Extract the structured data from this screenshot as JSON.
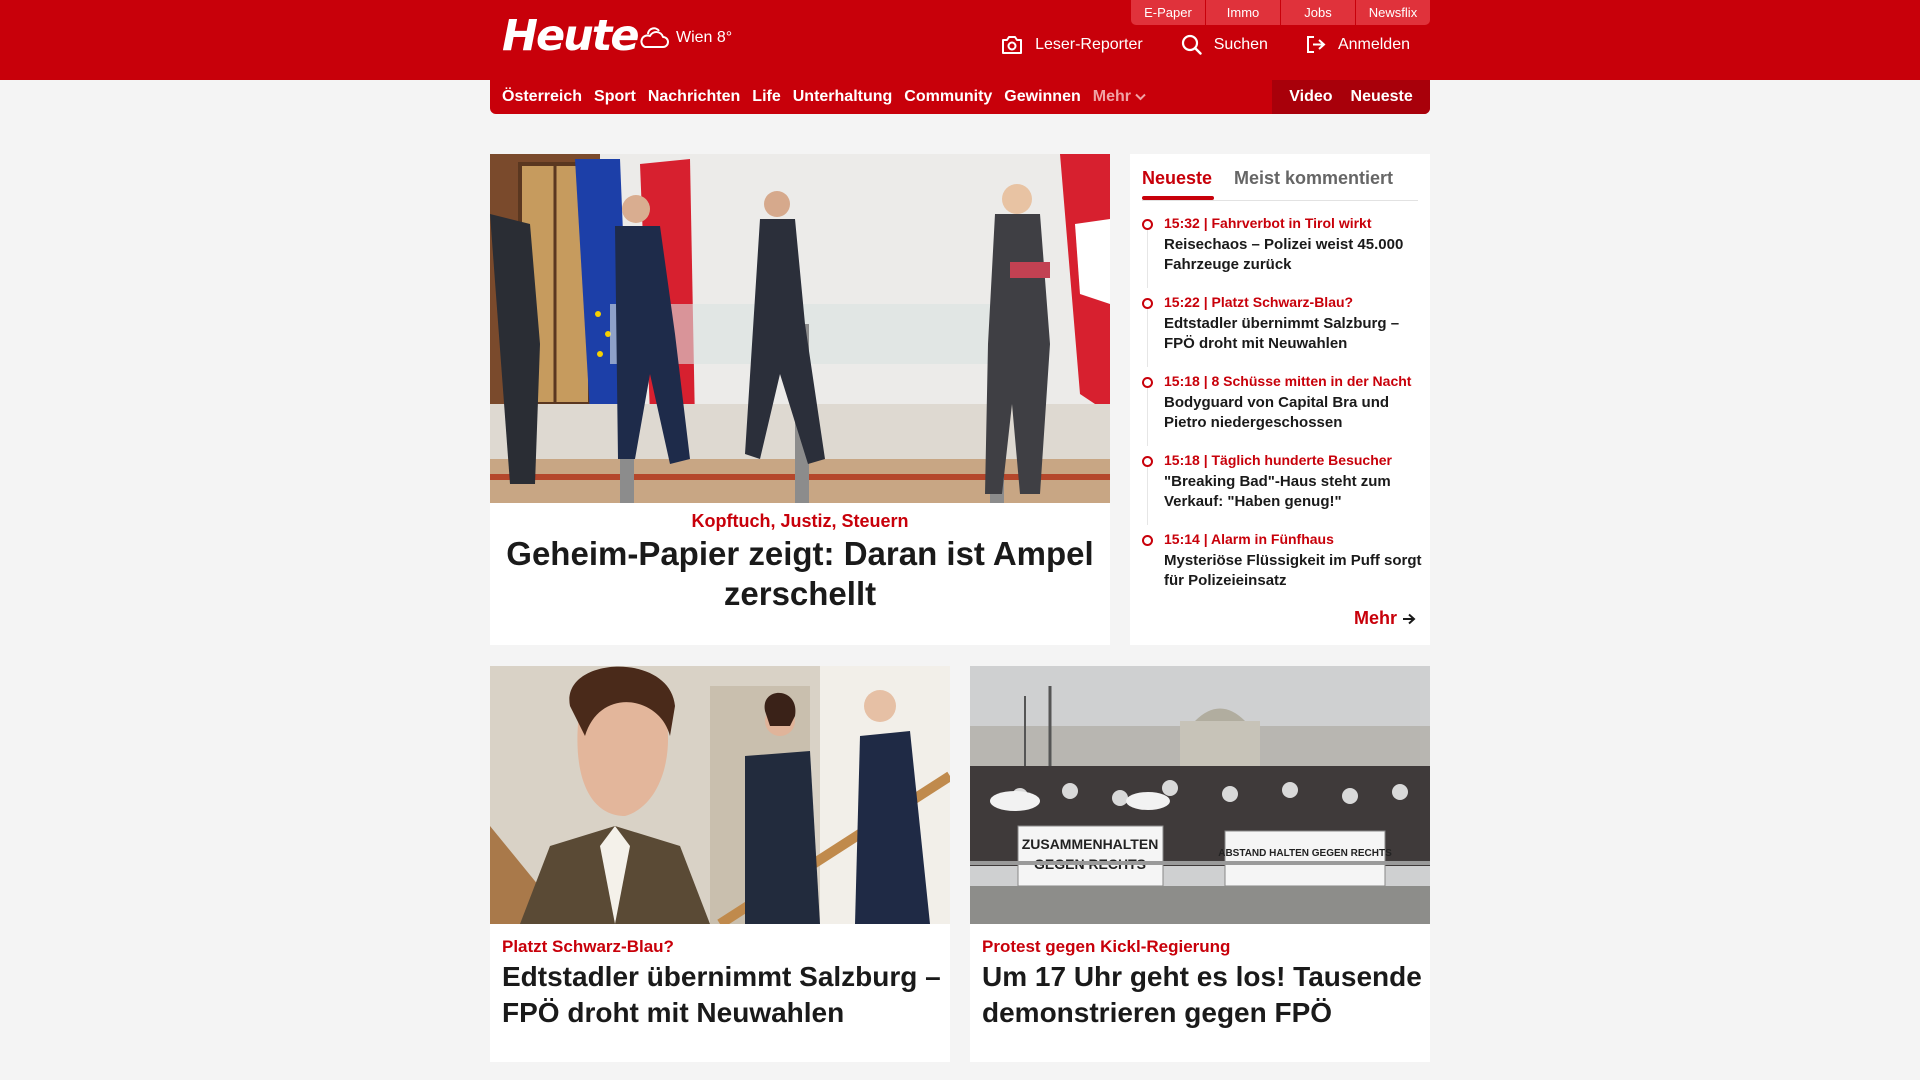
{
  "header": {
    "logo": "Heute",
    "weather": "Wien 8°",
    "top_links": [
      "E-Paper",
      "Immo",
      "Jobs",
      "Newsflix"
    ],
    "tools": {
      "reporter": "Leser-Reporter",
      "search": "Suchen",
      "login": "Anmelden"
    }
  },
  "nav": {
    "items": [
      "Österreich",
      "Sport",
      "Nachrichten",
      "Life",
      "Unterhaltung",
      "Community",
      "Gewinnen"
    ],
    "more": "Mehr",
    "video": "Video",
    "latest": "Neueste"
  },
  "hero": {
    "kicker": "Kopftuch, Justiz, Steuern",
    "title": "Geheim-Papier zeigt: Daran ist Ampel zerschellt"
  },
  "sidebar": {
    "tab_active": "Neueste",
    "tab_other": "Meist kommentiert",
    "items": [
      {
        "meta": "15:32 | Fahrverbot in Tirol wirkt",
        "title": "Reisechaos – Polizei weist 45.000 Fahrzeuge zurück"
      },
      {
        "meta": "15:22 | Platzt Schwarz-Blau?",
        "title": "Edtstadler übernimmt Salzburg – FPÖ droht mit Neuwahlen"
      },
      {
        "meta": "15:18 | 8 Schüsse mitten in der Nacht",
        "title": "Bodyguard von Capital Bra und Pietro  niedergeschossen"
      },
      {
        "meta": "15:18 | Täglich hunderte Besucher",
        "title": "\"Breaking Bad\"-Haus steht zum Verkauf: \"Haben genug!\""
      },
      {
        "meta": "15:14 | Alarm in Fünfhaus",
        "title": "Mysteriöse Flüssigkeit im Puff sorgt für Polizeieinsatz"
      }
    ],
    "more": "Mehr"
  },
  "cards": [
    {
      "kicker": "Platzt Schwarz-Blau?",
      "title": "Edtstadler übernimmt Salzburg – FPÖ droht mit Neuwahlen"
    },
    {
      "kicker": "Protest gegen Kickl-Regierung",
      "title": "Um 17 Uhr geht es los! Tausende demonstrieren gegen FPÖ"
    }
  ],
  "protest_banners": {
    "left_line1": "ZUSAMMENHALTEN",
    "left_line2": "GEGEN RECHTS",
    "right": "ABSTAND HALTEN GEGEN RECHTS"
  },
  "colors": {
    "brand_red": "#c8000a",
    "dark_red": "#a8000a",
    "background": "#f4f4f4"
  }
}
